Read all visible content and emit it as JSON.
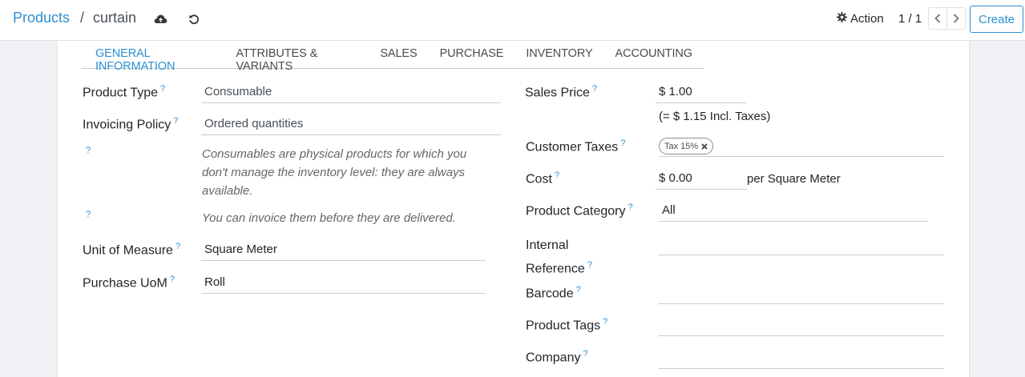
{
  "breadcrumb": {
    "root": "Products",
    "separator": "/",
    "current": "curtain"
  },
  "toolbar": {
    "action_label": "Action",
    "pager_value": "1 / 1",
    "create_label": "Create"
  },
  "tabs": [
    {
      "label": "GENERAL INFORMATION",
      "active": true
    },
    {
      "label": "ATTRIBUTES & VARIANTS",
      "active": false
    },
    {
      "label": "SALES",
      "active": false
    },
    {
      "label": "PURCHASE",
      "active": false
    },
    {
      "label": "INVENTORY",
      "active": false
    },
    {
      "label": "ACCOUNTING",
      "active": false
    }
  ],
  "help_mark": "?",
  "left": {
    "product_type": {
      "label": "Product Type",
      "value": "Consumable"
    },
    "invoicing_policy": {
      "label": "Invoicing Policy",
      "value": "Ordered quantities"
    },
    "consumable_note": "Consumables are physical products for which you don't manage the inventory level: they are always available.",
    "invoice_note": "You can invoice them before they are delivered.",
    "unit_of_measure": {
      "label": "Unit of Measure",
      "value": "Square Meter"
    },
    "purchase_uom": {
      "label": "Purchase UoM",
      "value": "Roll"
    }
  },
  "right": {
    "sales_price": {
      "label": "Sales Price",
      "value": "$ 1.00",
      "incl_taxes": "(= $ 1.15 Incl. Taxes)"
    },
    "customer_taxes": {
      "label": "Customer Taxes",
      "tags": [
        "Tax 15%"
      ]
    },
    "cost": {
      "label": "Cost",
      "value": "$ 0.00",
      "unit": "per Square Meter"
    },
    "product_category": {
      "label": "Product Category",
      "value": "All"
    },
    "internal_reference": {
      "label_line1": "Internal",
      "label_line2": "Reference",
      "value": ""
    },
    "barcode": {
      "label": "Barcode",
      "value": ""
    },
    "product_tags": {
      "label": "Product Tags",
      "value": ""
    },
    "company": {
      "label": "Company",
      "value": ""
    }
  },
  "colors": {
    "accent": "#2e8fd0",
    "background": "#f0f1f5",
    "sheet": "#ffffff"
  }
}
